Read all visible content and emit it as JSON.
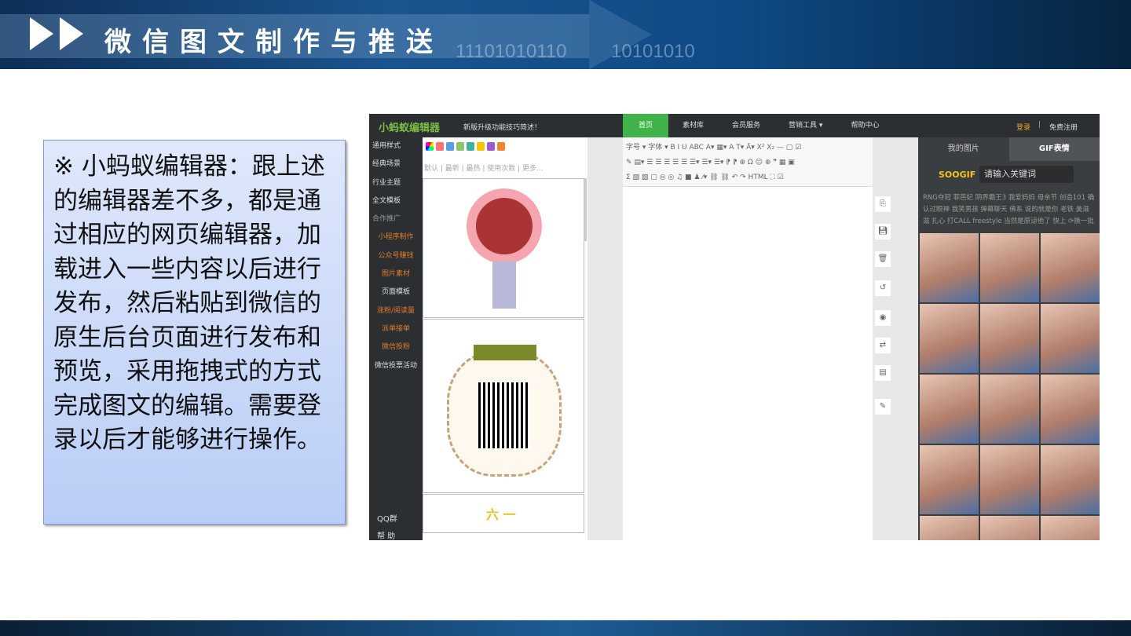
{
  "slide": {
    "title": "微信图文制作与推送",
    "bits": [
      "11101010110",
      "10101010"
    ]
  },
  "note": {
    "text": "※ 小蚂蚁编辑器：跟上述的编辑器差不多，都是通过相应的网页编辑器，加载进入一些内容以后进行发布，然后粘贴到微信的原生后台页面进行发布和预览，采用拖拽式的方式完成图文的编辑。需要登录以后才能够进行操作。"
  },
  "app": {
    "logo": "小蚂蚁编辑器",
    "notice": "新版升级功能技巧简述！",
    "nav": [
      "首页",
      "素材库",
      "会员服务",
      "营销工具 ▾",
      "帮助中心"
    ],
    "login": "登录",
    "separator": "|",
    "register": "免费注册",
    "leftnav": [
      "通用样式",
      "经典场景",
      "行业主题",
      "全文模板",
      "合作推广",
      "小程序制作",
      "公众号赚钱",
      "图片素材",
      "页面模板",
      "涨粉/阅读量",
      "派单接单",
      "微信投粉",
      "微信投票活动"
    ],
    "qq": "QQ群",
    "help": "帮 助",
    "filters": "默认 | 最新 | 最热 | 使用次数 | 更多...",
    "toolbar": [
      "字号 ▾ 字体 ▾ B I U ABC A▾ ▦▾ A T▾ Ä▾ X² X₂ — ▢ ☑",
      "✎ ▤▾ ☰ ☰ ☰ ☰ ☰ ☰▾ ☰▾ ☰▾ ⁋ ⁋ ⊕ Ω ☺ ⊕ ❞ ▦ ▣",
      "Σ ▨ ▨ ▢ ◎ ◎ ♫ ■ ♟ ⁄▾ ⛓ ⛓ ↶ ↷ HTML ⛶ ☑"
    ],
    "right_tabs": [
      "我的图片",
      "GIF表情"
    ],
    "gif_logo": "SOOGIF",
    "search_placeholder": "请输入关键词",
    "tags": [
      "RNG夺冠 菲芭妃 阴界霸王3 我爱妈妈 母亲节 创造101 确",
      "认过眼神 我笑男孩 弹幕聊天 佛系 说的就是你 老铁 美滋",
      "滋 扎心 打CALL freestyle 当然是原谅他了 快上 ⟳换一批"
    ]
  },
  "colors": {
    "accent": "#3fb24a",
    "orange": "#e07b2b",
    "swatches": [
      "#ff7070",
      "#5a9be8",
      "#8cc56a",
      "#3bb5a0",
      "#f7c400",
      "#a05ad0",
      "#f0852a"
    ]
  }
}
